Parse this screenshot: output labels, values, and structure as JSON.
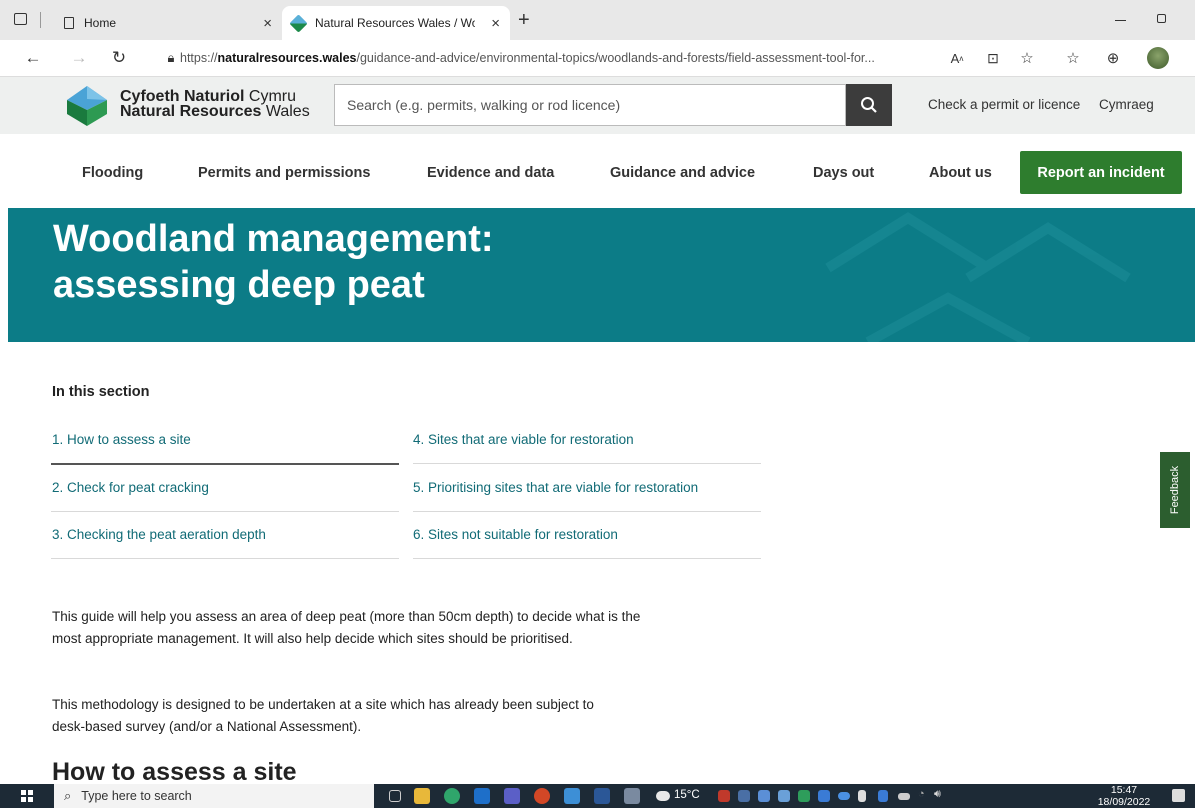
{
  "browser": {
    "tabs": [
      {
        "title": "Home"
      },
      {
        "title": "Natural Resources Wales / Wood"
      }
    ],
    "url_prefix": "https://",
    "url_domain": "naturalresources.wales",
    "url_path": "/guidance-and-advice/environmental-topics/woodlands-and-forests/field-assessment-tool-for...",
    "new_tab_label": "+"
  },
  "header": {
    "logo_line1_bold": "Cyfoeth Naturiol",
    "logo_line1_light": " Cymru",
    "logo_line2_bold": "Natural Resources",
    "logo_line2_light": " Wales",
    "search_placeholder": "Search (e.g. permits, walking or rod licence)",
    "link_permit": "Check a permit or licence",
    "link_language": "Cymraeg"
  },
  "nav": {
    "items": [
      "Flooding",
      "Permits and permissions",
      "Evidence and data",
      "Guidance and advice",
      "Days out",
      "About us"
    ],
    "report_button": "Report an incident"
  },
  "page": {
    "title_line1": "Woodland management:",
    "title_line2": "assessing deep peat",
    "section_heading": "In this section",
    "toc": [
      "1. How to assess a site",
      "2. Check for peat cracking",
      "3. Checking the peat aeration depth",
      "4. Sites that are viable for restoration",
      "5. Prioritising sites that are viable for restoration",
      "6. Sites not suitable for restoration"
    ],
    "para1": "This guide will help you assess an area of deep peat (more than 50cm depth) to decide what is the most appropriate management. It will also help decide which sites should be prioritised.",
    "para2": "This methodology is designed to be undertaken at a site which has already been subject to desk-based survey (and/or a National Assessment).",
    "next_heading": "How to assess a site",
    "feedback": "Feedback"
  },
  "taskbar": {
    "search_placeholder": "Type here to search",
    "weather": "15°C",
    "time": "15:47",
    "date": "18/09/2022"
  },
  "colors": {
    "teal": "#0c7c87",
    "link": "#116b76",
    "green": "#2e7d2e"
  }
}
